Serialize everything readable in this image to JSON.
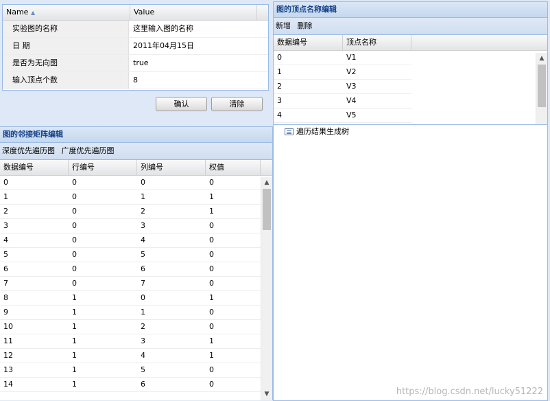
{
  "property_grid": {
    "col_name": "Name",
    "col_value": "Value",
    "rows": [
      {
        "name": "实验图的名称",
        "value": "这里输入图的名称"
      },
      {
        "name": "日 期",
        "value": "2011年04月15日"
      },
      {
        "name": "是否为无向图",
        "value": "true"
      },
      {
        "name": "输入顶点个数",
        "value": "8"
      }
    ],
    "confirm_label": "确认",
    "clear_label": "清除"
  },
  "vertex_panel": {
    "title": "图的顶点名称编辑",
    "toolbar": {
      "add": "新增",
      "delete": "删除"
    },
    "columns": [
      "数据编号",
      "顶点名称"
    ],
    "rows": [
      [
        "0",
        "V1"
      ],
      [
        "1",
        "V2"
      ],
      [
        "2",
        "V3"
      ],
      [
        "3",
        "V4"
      ],
      [
        "4",
        "V5"
      ]
    ]
  },
  "matrix_panel": {
    "title": "图的邻接矩阵编辑",
    "toolbar": {
      "dfs": "深度优先遍历图",
      "bfs": "广度优先遍历图"
    },
    "columns": [
      "数据编号",
      "行编号",
      "列编号",
      "权值"
    ],
    "rows": [
      [
        "0",
        "0",
        "0",
        "0"
      ],
      [
        "1",
        "0",
        "1",
        "1"
      ],
      [
        "2",
        "0",
        "2",
        "1"
      ],
      [
        "3",
        "0",
        "3",
        "0"
      ],
      [
        "4",
        "0",
        "4",
        "0"
      ],
      [
        "5",
        "0",
        "5",
        "0"
      ],
      [
        "6",
        "0",
        "6",
        "0"
      ],
      [
        "7",
        "0",
        "7",
        "0"
      ],
      [
        "8",
        "1",
        "0",
        "1"
      ],
      [
        "9",
        "1",
        "1",
        "0"
      ],
      [
        "10",
        "1",
        "2",
        "0"
      ],
      [
        "11",
        "1",
        "3",
        "1"
      ],
      [
        "12",
        "1",
        "4",
        "1"
      ],
      [
        "13",
        "1",
        "5",
        "0"
      ],
      [
        "14",
        "1",
        "6",
        "0"
      ]
    ]
  },
  "tree_panel": {
    "item_label": "遍历结果生成树"
  },
  "watermark": "https://blog.csdn.net/lucky51222"
}
